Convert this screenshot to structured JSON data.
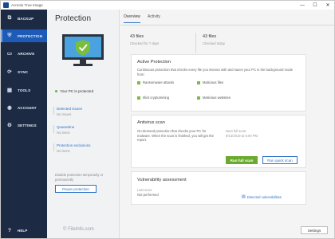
{
  "window": {
    "title": "Acronis True Image",
    "minimize": "—",
    "maximize": "☐",
    "close": "✕"
  },
  "sidebar": {
    "items": [
      {
        "label": "BACKUP",
        "icon": "backup-icon",
        "glyph": "⧉"
      },
      {
        "label": "PROTECTION",
        "icon": "shield-icon",
        "glyph": "⛨"
      },
      {
        "label": "ARCHIVE",
        "icon": "archive-icon",
        "glyph": "▭"
      },
      {
        "label": "SYNC",
        "icon": "sync-icon",
        "glyph": "⟳"
      },
      {
        "label": "TOOLS",
        "icon": "tools-icon",
        "glyph": "▦"
      },
      {
        "label": "ACCOUNT",
        "icon": "account-icon",
        "glyph": "◉"
      },
      {
        "label": "SETTINGS",
        "icon": "gear-icon",
        "glyph": "⚙"
      }
    ],
    "help": {
      "label": "HELP",
      "icon": "help-icon",
      "glyph": "?"
    }
  },
  "panel": {
    "title": "Protection",
    "status": "Your PC is protected",
    "links": [
      {
        "label": "Detected issues",
        "sub": "No issues"
      },
      {
        "label": "Quarantine",
        "sub": "No items"
      },
      {
        "label": "Protection exclusions",
        "sub": "No items"
      }
    ],
    "disable_text": "Disable protection temporarily or permanently",
    "pause_button": "Pause protection"
  },
  "tabs": [
    "Overview",
    "Activity"
  ],
  "stats": [
    {
      "value": "43 files",
      "label": "Checked for 7 days"
    },
    {
      "value": "43 files",
      "label": "Checked today"
    }
  ],
  "active_protection": {
    "title": "Active Protection",
    "desc": "Continuous protection that checks every file you interact with and saves your PC in the background mode from:",
    "features": [
      "Ransomware attacks",
      "Malicious files",
      "Illicit cryptomining",
      "Malicious websites"
    ]
  },
  "antivirus": {
    "title": "Antivirus scan",
    "desc": "On-demand protection that checks your PC for malware. When the scan is finished, you will get the report.",
    "next_scan_label": "Next full scan:",
    "next_scan_value": "9/13/2019 at 6:00 PM",
    "run_full": "Run full scan",
    "run_quick": "Run quick scan"
  },
  "vulnerability": {
    "title": "Vulnerability assessment",
    "last_scan_label": "Last scan:",
    "last_scan_value": "Not performed",
    "link": "Detected vulnerabilities"
  },
  "settings_button": "Settings",
  "watermark": "© FileInfo.com",
  "colors": {
    "sidebar": "#1c2a44",
    "active_nav": "#1e5bb8",
    "accent": "#2b73c7",
    "ok_green": "#6cb33f",
    "run_button": "#6aaa2e"
  }
}
